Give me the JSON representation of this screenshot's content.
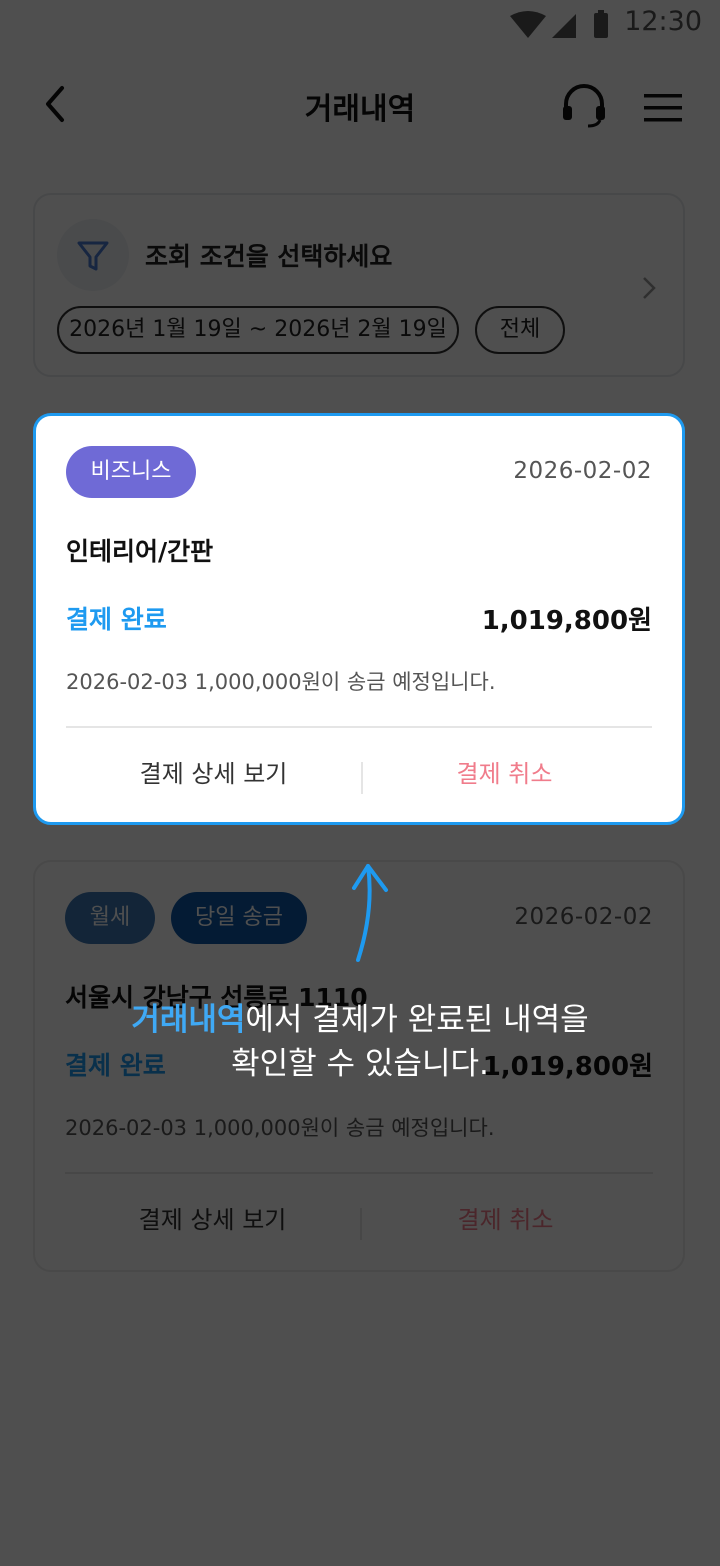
{
  "status_bar": {
    "time": "12:30"
  },
  "header": {
    "title": "거래내역"
  },
  "filter": {
    "title": "조회 조건을 선택하세요",
    "date_range": "2026년 1월 19일 ~ 2026년 2월 19일",
    "type": "전체"
  },
  "transactions": [
    {
      "badges": [
        "비즈니스"
      ],
      "date": "2026-02-02",
      "title": "인테리어/간판",
      "status": "결제 완료",
      "amount": "1,019,800원",
      "note": "2026-02-03 1,000,000원이 송금 예정입니다.",
      "detail_label": "결제 상세 보기",
      "cancel_label": "결제 취소"
    },
    {
      "badges": [
        "월세",
        "당일 송금"
      ],
      "date": "2026-02-02",
      "title": "서울시 강남구 선릉로 1110",
      "status": "결제 완료",
      "amount": "1,019,800원",
      "note": "2026-02-03 1,000,000원이 송금 예정입니다.",
      "detail_label": "결제 상세 보기",
      "cancel_label": "결제 취소"
    }
  ],
  "hint": {
    "highlight": "거래내역",
    "line1_rest": "에서 결제가 완료된 내역을",
    "line2": "확인할 수 있습니다."
  },
  "colors": {
    "accent": "#1e9af0",
    "business_badge": "#6f6ad6",
    "rent_badge": "#3d79b5",
    "same_day_badge": "#0d58a8",
    "cancel": "#f07c8b"
  }
}
